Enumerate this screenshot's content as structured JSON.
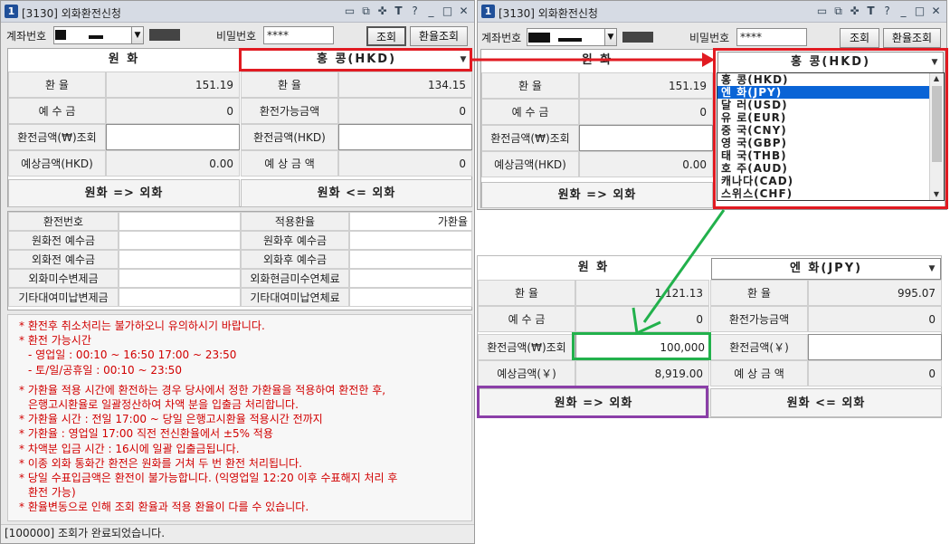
{
  "colors": {
    "accent": "#1f4f99",
    "warning": "#d10000",
    "highlight_red": "#e11b22",
    "highlight_green": "#22b14c",
    "highlight_purple": "#8b3fa8",
    "selection": "#0a64d6"
  },
  "window_left": {
    "number": "1",
    "title": "[3130] 외화환전신청",
    "icons": [
      "dock-icon",
      "restore-icon",
      "pin-icon",
      "font-icon",
      "help-icon",
      "minimize-icon",
      "maximize-icon",
      "close-icon"
    ],
    "account_label": "계좌번호",
    "password_label": "비밀번호",
    "password_value": "****",
    "btn_query": "조회",
    "btn_rate": "환율조회",
    "krw_header": "원       화",
    "fx_select": "홍   콩(HKD)",
    "rows_left": [
      {
        "label": "환      율",
        "value": "151.19"
      },
      {
        "label": "예  수  금",
        "value": "0"
      },
      {
        "label": "환전금액(₩)조회",
        "value": ""
      },
      {
        "label": "예상금액(HKD)",
        "value": "0.00"
      }
    ],
    "rows_right": [
      {
        "label": "환      율",
        "value": "134.15"
      },
      {
        "label": "환전가능금액",
        "value": "0"
      },
      {
        "label": "환전금액(HKD)",
        "value": ""
      },
      {
        "label": "예 상 금 액",
        "value": "0"
      }
    ],
    "btn_krw_to_fx": "원화  =>  외화",
    "btn_fx_to_krw": "원화  <=  외화",
    "info_rows": [
      {
        "a": "환전번호",
        "b": "",
        "c": "적용환율",
        "d": "가환율"
      },
      {
        "a": "원화전 예수금",
        "b": "",
        "c": "원화후 예수금",
        "d": ""
      },
      {
        "a": "외화전 예수금",
        "b": "",
        "c": "외화후 예수금",
        "d": ""
      },
      {
        "a": "외화미수변제금",
        "b": "",
        "c": "외화현금미수연체료",
        "d": ""
      },
      {
        "a": "기타대여미납변제금",
        "b": "",
        "c": "기타대여미납연체료",
        "d": ""
      }
    ],
    "notices": [
      "* 환전후 취소처리는 불가하오니 유의하시기 바랍니다.",
      "* 환전 가능시간",
      "   - 영업일 : 00:10 ~ 16:50 17:00 ~ 23:50",
      "   - 토/일/공휴일 : 00:10 ~ 23:50",
      "",
      "* 가환율 적용 시간에 환전하는 경우 당사에서 정한 가환율을 적용하여 환전한 후,",
      "   은행고시환율로 일괄정산하여 차액 분을 입출금 처리합니다.",
      "* 가환율 시간 : 전일 17:00 ~ 당일 은행고시환율 적용시간 전까지",
      "* 가환율 : 영업일 17:00 직전 전신환율에서 ±5% 적용",
      "* 차액분 입금 시간 : 16시에 일괄 입출금됩니다.",
      "* 이종 외화 통화간 환전은 원화를 거쳐 두 번 환전 처리됩니다.",
      "* 당일 수표입금액은 환전이 불가능합니다. (익영업일 12:20 이후 수표해지 처리 후",
      "   환전 가능)",
      "* 환율변동으로 인해 조회 환율과 적용 환율이 다를 수 있습니다."
    ],
    "status": "[100000] 조회가 완료되었습니다."
  },
  "window_right": {
    "number": "1",
    "title": "[3130] 외화환전신청",
    "account_label": "계좌번호",
    "password_label": "비밀번호",
    "password_value": "****",
    "btn_query": "조회",
    "btn_rate": "환율조회",
    "krw_header": "원       화",
    "fx_select": "홍   콩(HKD)",
    "rows_left": [
      {
        "label": "환      율",
        "value": "151.19"
      },
      {
        "label": "예  수  금",
        "value": "0"
      },
      {
        "label": "환전금액(₩)조회",
        "value": ""
      },
      {
        "label": "예상금액(HKD)",
        "value": "0.00"
      }
    ],
    "btn_krw_to_fx": "원화  =>  외화",
    "currency_options": [
      {
        "label": "홍   콩(HKD)",
        "selected": false
      },
      {
        "label": "엔   화(JPY)",
        "selected": true
      },
      {
        "label": "달   러(USD)",
        "selected": false
      },
      {
        "label": "유   로(EUR)",
        "selected": false
      },
      {
        "label": "중   국(CNY)",
        "selected": false
      },
      {
        "label": "영   국(GBP)",
        "selected": false
      },
      {
        "label": "태   국(THB)",
        "selected": false
      },
      {
        "label": "호   주(AUD)",
        "selected": false
      },
      {
        "label": "캐나다(CAD)",
        "selected": false
      },
      {
        "label": "스위스(CHF)",
        "selected": false
      }
    ]
  },
  "result_panel": {
    "krw_header": "원       화",
    "fx_select": "엔   화(JPY)",
    "rows_left": [
      {
        "label": "환      율",
        "value": "1,121.13"
      },
      {
        "label": "예  수  금",
        "value": "0"
      },
      {
        "label": "환전금액(₩)조회",
        "value": "100,000"
      },
      {
        "label": "예상금액(￥)",
        "value": "8,919.00"
      }
    ],
    "rows_right": [
      {
        "label": "환      율",
        "value": "995.07"
      },
      {
        "label": "환전가능금액",
        "value": "0"
      },
      {
        "label": "환전금액(￥)",
        "value": ""
      },
      {
        "label": "예 상 금 액",
        "value": "0"
      }
    ],
    "btn_krw_to_fx": "원화  =>  외화",
    "btn_fx_to_krw": "원화  <=  외화"
  }
}
